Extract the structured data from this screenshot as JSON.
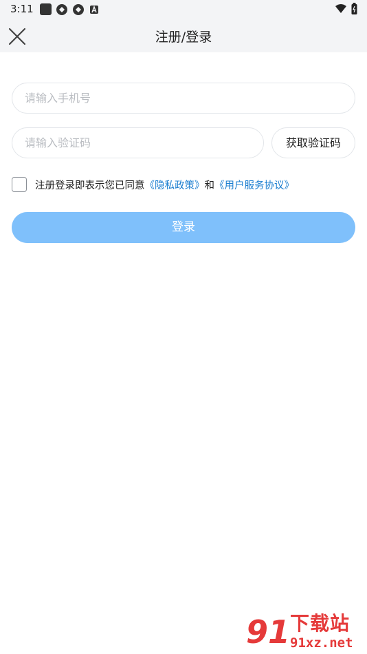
{
  "status_bar": {
    "time": "3:11",
    "left_icons": [
      "app-square-icon",
      "sync-icon",
      "sync-icon",
      "a-badge-icon"
    ],
    "right_icons": [
      "wifi-icon",
      "battery-icon"
    ]
  },
  "header": {
    "title": "注册/登录",
    "close_icon": "close-icon"
  },
  "form": {
    "phone_placeholder": "请输入手机号",
    "phone_value": "",
    "code_placeholder": "请输入验证码",
    "code_value": "",
    "get_code_label": "获取验证码",
    "agreement": {
      "checked": false,
      "prefix": "注册登录即表示您已同意",
      "privacy_link": "《隐私政策》",
      "conjunction": "和",
      "terms_link": "《用户服务协议》"
    },
    "login_label": "登录"
  },
  "watermark": {
    "brand_number": "91",
    "brand_text": "下载站",
    "url": "91xz.net"
  },
  "colors": {
    "header_bg": "#f3f4f6",
    "link": "#1d7fd0",
    "login_button": "#7fc0fb",
    "watermark": "#e53a3a"
  }
}
